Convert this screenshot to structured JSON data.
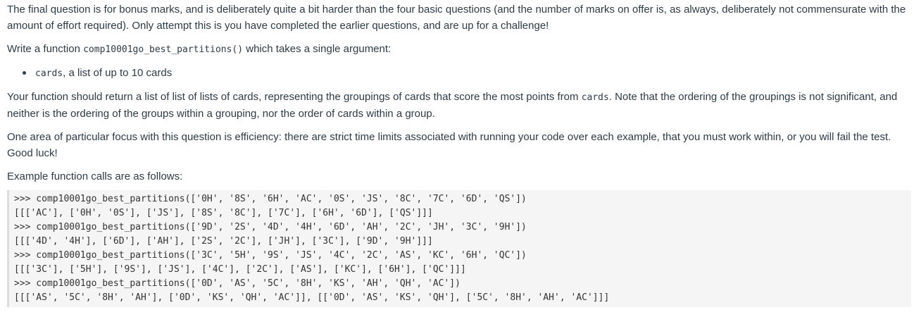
{
  "intro": "The final question is for bonus marks, and is deliberately quite a bit harder than the four basic questions (and the number of marks on offer is, as always, deliberately not commensurate with the amount of effort required). Only attempt this is you have completed the earlier questions, and are up for a challenge!",
  "write": {
    "before": "Write a function ",
    "code": "comp10001go_best_partitions()",
    "after": " which takes a single argument:"
  },
  "args": [
    {
      "code": "cards",
      "text": ", a list of up to 10 cards"
    }
  ],
  "returns": {
    "before": "Your function should return a list of list of lists of cards, representing the groupings of cards that score the most points from ",
    "code": "cards",
    "after": ". Note that the ordering of the groupings is not significant, and neither is the ordering of the groups within a grouping, nor the order of cards within a group."
  },
  "efficiency": "One area of particular focus with this question is efficiency: there are strict time limits associated with running your code over each example, that you must work within, or you will fail the test. Good luck!",
  "examples_label": "Example function calls are as follows:",
  "code_lines": [
    ">>> comp10001go_best_partitions(['0H', '8S', '6H', 'AC', '0S', 'JS', '8C', '7C', '6D', 'QS'])",
    "[[['AC'], ['0H', '0S'], ['JS'], ['8S', '8C'], ['7C'], ['6H', '6D'], ['QS']]]",
    ">>> comp10001go_best_partitions(['9D', '2S', '4D', '4H', '6D', 'AH', '2C', 'JH', '3C', '9H'])",
    "[[['4D', '4H'], ['6D'], ['AH'], ['2S', '2C'], ['JH'], ['3C'], ['9D', '9H']]]",
    ">>> comp10001go_best_partitions(['3C', '5H', '9S', 'JS', '4C', '2C', 'AS', 'KC', '6H', 'QC'])",
    "[[['3C'], ['5H'], ['9S'], ['JS'], ['4C'], ['2C'], ['AS'], ['KC'], ['6H'], ['QC']]]",
    ">>> comp10001go_best_partitions(['0D', 'AS', '5C', '8H', 'KS', 'AH', 'QH', 'AC'])",
    "[[['AS', '5C', '8H', 'AH'], ['0D', 'KS', 'QH', 'AC']], [['0D', 'AS', 'KS', 'QH'], ['5C', '8H', 'AH', 'AC']]]"
  ]
}
